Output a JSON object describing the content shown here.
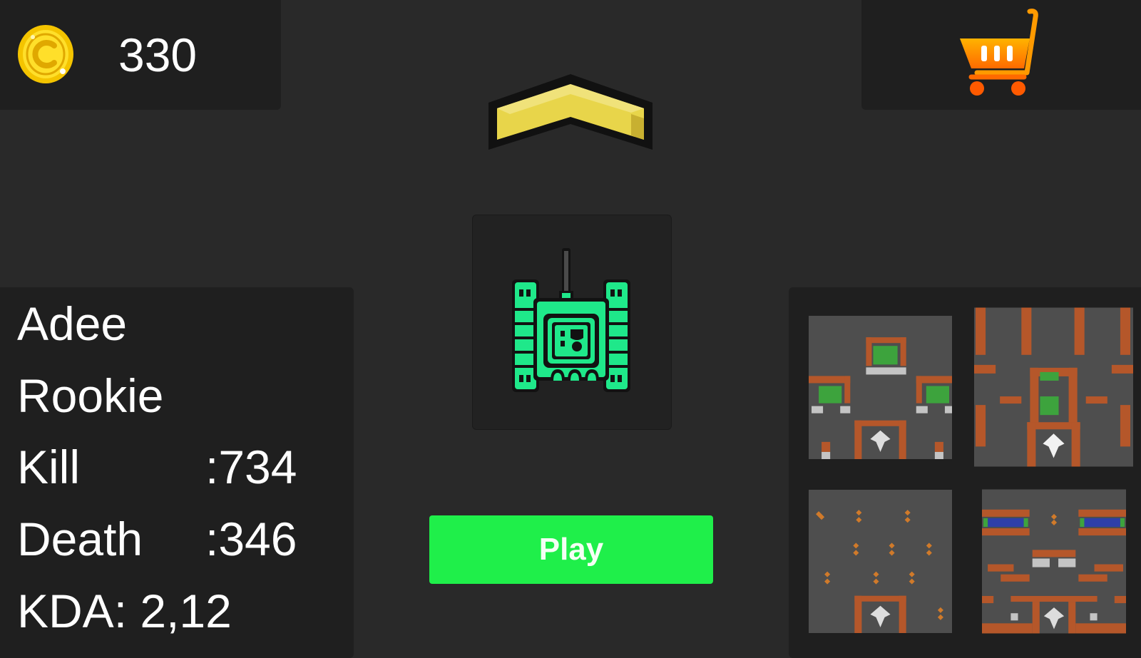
{
  "currency": {
    "coins": "330",
    "icon": "coin-icon"
  },
  "shop": {
    "icon": "shopping-cart-icon"
  },
  "rank": {
    "icon": "rank-chevron-icon",
    "color": "#e8d54a"
  },
  "tank": {
    "icon": "tank-icon",
    "color": "#1fe88a"
  },
  "player": {
    "name": "Adee",
    "rank_title": "Rookie",
    "kill_label": "Kill",
    "kill_value": ":734",
    "death_label": "Death",
    "death_value": ":346",
    "kda": "KDA: 2,12"
  },
  "play_button": {
    "label": "Play",
    "color": "#1fef4a"
  },
  "maps": [
    {
      "id": "map-1",
      "icon": "map-thumbnail-1"
    },
    {
      "id": "map-2",
      "icon": "map-thumbnail-2"
    },
    {
      "id": "map-3",
      "icon": "map-thumbnail-3"
    },
    {
      "id": "map-4",
      "icon": "map-thumbnail-4"
    }
  ]
}
